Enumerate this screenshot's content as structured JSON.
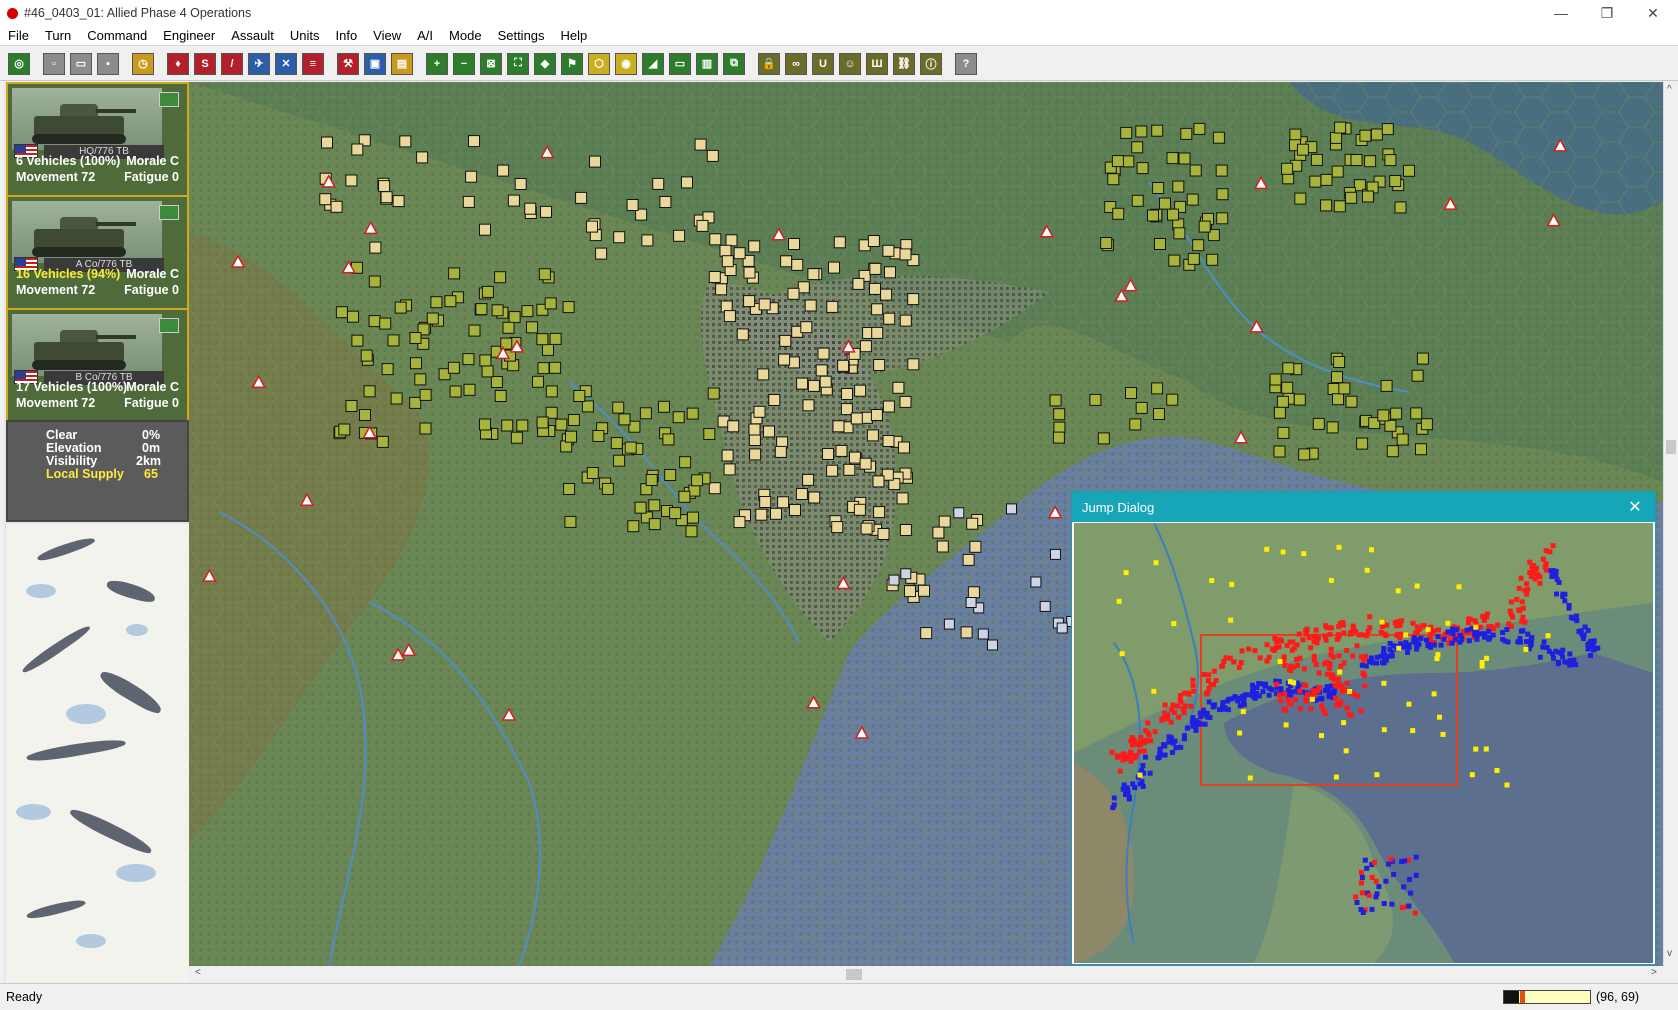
{
  "window": {
    "title": "#46_0403_01: Allied Phase 4 Operations",
    "minimize_glyph": "—",
    "restore_glyph": "❐",
    "close_glyph": "✕"
  },
  "menu": [
    "File",
    "Turn",
    "Command",
    "Engineer",
    "Assault",
    "Units",
    "Info",
    "View",
    "A/I",
    "Mode",
    "Settings",
    "Help"
  ],
  "toolbar": {
    "buttons": [
      {
        "icon": "select-unit-icon",
        "glyph": "◎",
        "color": "#2d7d2d"
      },
      {
        "icon": "new-icon",
        "glyph": "▫",
        "color": "#8c8c8c"
      },
      {
        "icon": "open-icon",
        "glyph": "▭",
        "color": "#8c8c8c"
      },
      {
        "icon": "save-icon",
        "glyph": "▪",
        "color": "#8c8c8c"
      },
      {
        "icon": "clock-icon",
        "glyph": "◷",
        "color": "#c89a1e"
      },
      {
        "icon": "assault-icon",
        "glyph": "♦",
        "color": "#b3202a"
      },
      {
        "icon": "supply-icon",
        "glyph": "S",
        "color": "#b3202a"
      },
      {
        "icon": "artillery-icon",
        "glyph": "/",
        "color": "#b3202a"
      },
      {
        "icon": "aircraft-icon",
        "glyph": "✈",
        "color": "#2c5ea8"
      },
      {
        "icon": "cross-icon",
        "glyph": "✕",
        "color": "#2c5ea8"
      },
      {
        "icon": "list-icon",
        "glyph": "≡",
        "color": "#b3202a"
      },
      {
        "icon": "engineer-icon",
        "glyph": "⚒",
        "color": "#b3202a"
      },
      {
        "icon": "fortify-icon",
        "glyph": "▣",
        "color": "#2c5ea8"
      },
      {
        "icon": "unit-info-icon",
        "glyph": "▤",
        "color": "#c89a1e"
      },
      {
        "icon": "zoom-in-icon",
        "glyph": "+",
        "color": "#2d7d2d"
      },
      {
        "icon": "zoom-out-icon",
        "glyph": "−",
        "color": "#2d7d2d"
      },
      {
        "icon": "fit-icon",
        "glyph": "⊠",
        "color": "#2d7d2d"
      },
      {
        "icon": "full-screen-icon",
        "glyph": "⛶",
        "color": "#2d7d2d"
      },
      {
        "icon": "layers-icon",
        "glyph": "◆",
        "color": "#2d7d2d"
      },
      {
        "icon": "flag-icon",
        "glyph": "⚑",
        "color": "#2d7d2d"
      },
      {
        "icon": "hex-outline-icon",
        "glyph": "⬡",
        "color": "#c8b020"
      },
      {
        "icon": "objective-icon",
        "glyph": "◉",
        "color": "#c8b020"
      },
      {
        "icon": "terrain-icon",
        "glyph": "◢",
        "color": "#2d7d2d"
      },
      {
        "icon": "monitor-icon",
        "glyph": "▭",
        "color": "#2d7d2d"
      },
      {
        "icon": "map-icon",
        "glyph": "▥",
        "color": "#2d7d2d"
      },
      {
        "icon": "jump-map-icon",
        "glyph": "⧉",
        "color": "#2d7d2d"
      },
      {
        "icon": "lock-icon",
        "glyph": "🔒",
        "color": "#6b6b2a"
      },
      {
        "icon": "binoculars-icon",
        "glyph": "∞",
        "color": "#6b6b2a"
      },
      {
        "icon": "unit-box-icon",
        "glyph": "U",
        "color": "#6b6b2a"
      },
      {
        "icon": "smile-icon",
        "glyph": "☺",
        "color": "#6b6b2a"
      },
      {
        "icon": "stack-icon",
        "glyph": "Ш",
        "color": "#6b6b2a"
      },
      {
        "icon": "org-chart-icon",
        "glyph": "⛓",
        "color": "#6b6b2a"
      },
      {
        "icon": "info-icon",
        "glyph": "ⓘ",
        "color": "#6b6b2a"
      },
      {
        "icon": "help-icon",
        "glyph": "?",
        "color": "#8c8c8c"
      }
    ]
  },
  "units": [
    {
      "name": "HQ/776 TB",
      "strength": "6 Vehicles (100%)",
      "morale": "Morale C",
      "movement": "Movement 72",
      "fatigue": "Fatigue 0",
      "strength_highlight": false
    },
    {
      "name": "A Co/776 TB",
      "strength": "16 Vehicles (94%)",
      "morale": "Morale C",
      "movement": "Movement 72",
      "fatigue": "Fatigue 0",
      "strength_highlight": true
    },
    {
      "name": "B Co/776 TB",
      "strength": "17 Vehicles (100%)",
      "morale": "Morale C",
      "movement": "Movement 72",
      "fatigue": "Fatigue 0",
      "strength_highlight": false
    }
  ],
  "terrain_info": {
    "rows": [
      {
        "label": "Clear",
        "value": "0%",
        "highlight": false
      },
      {
        "label": "Elevation",
        "value": "0m",
        "highlight": false
      },
      {
        "label": "Visibility",
        "value": "2km",
        "highlight": false
      },
      {
        "label": "Local Supply",
        "value": "65",
        "highlight": true
      }
    ]
  },
  "jump_dialog": {
    "title": "Jump Dialog",
    "close_glyph": "✕"
  },
  "status": {
    "text": "Ready",
    "coords": "(96, 69)",
    "progress_fraction": 0.18,
    "marker_fraction": 0.19
  },
  "scroll": {
    "h_left": "<",
    "h_right": ">",
    "v_up": "^",
    "v_down": "v"
  },
  "colors": {
    "allied": "#1f1fe0",
    "japanese": "#ff1a1a",
    "objective": "#ffee00",
    "title_accent": "#16a6b8"
  }
}
